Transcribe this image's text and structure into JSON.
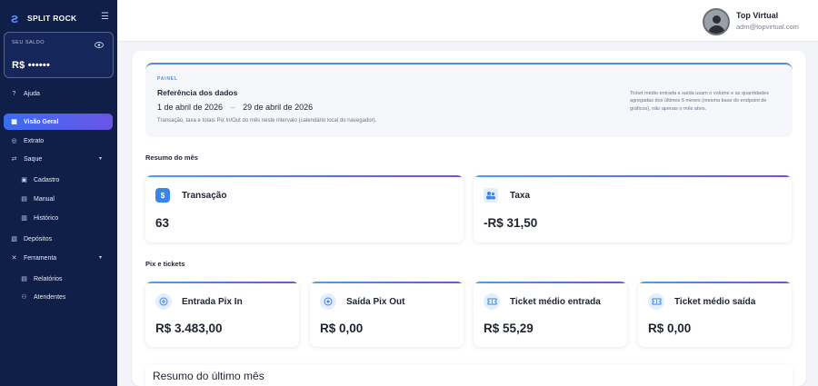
{
  "sidebar": {
    "brand": "SPLIT ROCK",
    "balance": {
      "label": "SEU SALDO",
      "value": "R$ ••••••"
    },
    "items": [
      {
        "label": "Ajuda"
      },
      {
        "label": "Visão Geral"
      },
      {
        "label": "Extrato"
      },
      {
        "label": "Saque"
      },
      {
        "label": "Cadastro"
      },
      {
        "label": "Manual"
      },
      {
        "label": "Histórico"
      },
      {
        "label": "Depósitos"
      },
      {
        "label": "Ferramenta"
      },
      {
        "label": "Relatórios"
      },
      {
        "label": "Atendentes"
      }
    ]
  },
  "header": {
    "user_name": "Top Virtual",
    "user_email": "adm@topvirtual.com"
  },
  "reference": {
    "kicker": "PAINEL",
    "title": "Referência dos dados",
    "date_start": "1 de abril de 2026",
    "date_end": "29 de abril de 2026",
    "date_sep": "–",
    "note": "Transação, taxa e totais Pix In/Out do mês neste intervalo (calendário local do navegador).",
    "side_note": "Ticket médio entrada e saída usam o volume e as quantidades agregadas dos últimos 6 meses (mesma base do endpoint de gráficos), não apenas o mês ativo."
  },
  "summary": {
    "title": "Resumo do mês",
    "cards": [
      {
        "label": "Transação",
        "value": "63",
        "icon": "dollar-icon"
      },
      {
        "label": "Taxa",
        "value": "-R$ 31,50",
        "icon": "people-icon"
      }
    ]
  },
  "pix": {
    "title": "Pix e tickets",
    "cards": [
      {
        "label": "Entrada Pix In",
        "value": "R$ 3.483,00",
        "icon": "arrow-in-icon"
      },
      {
        "label": "Saída Pix Out",
        "value": "R$ 0,00",
        "icon": "arrow-out-icon"
      },
      {
        "label": "Ticket médio entrada",
        "value": "R$ 55,29",
        "icon": "ticket-icon"
      },
      {
        "label": "Ticket médio saída",
        "value": "R$ 0,00",
        "icon": "ticket-icon"
      }
    ]
  },
  "last_month": {
    "title": "Resumo do último mês"
  },
  "colors": {
    "sidebar_bg": "#0f1f47",
    "accent": "#3a6cf0",
    "accent2": "#6a55e6"
  }
}
